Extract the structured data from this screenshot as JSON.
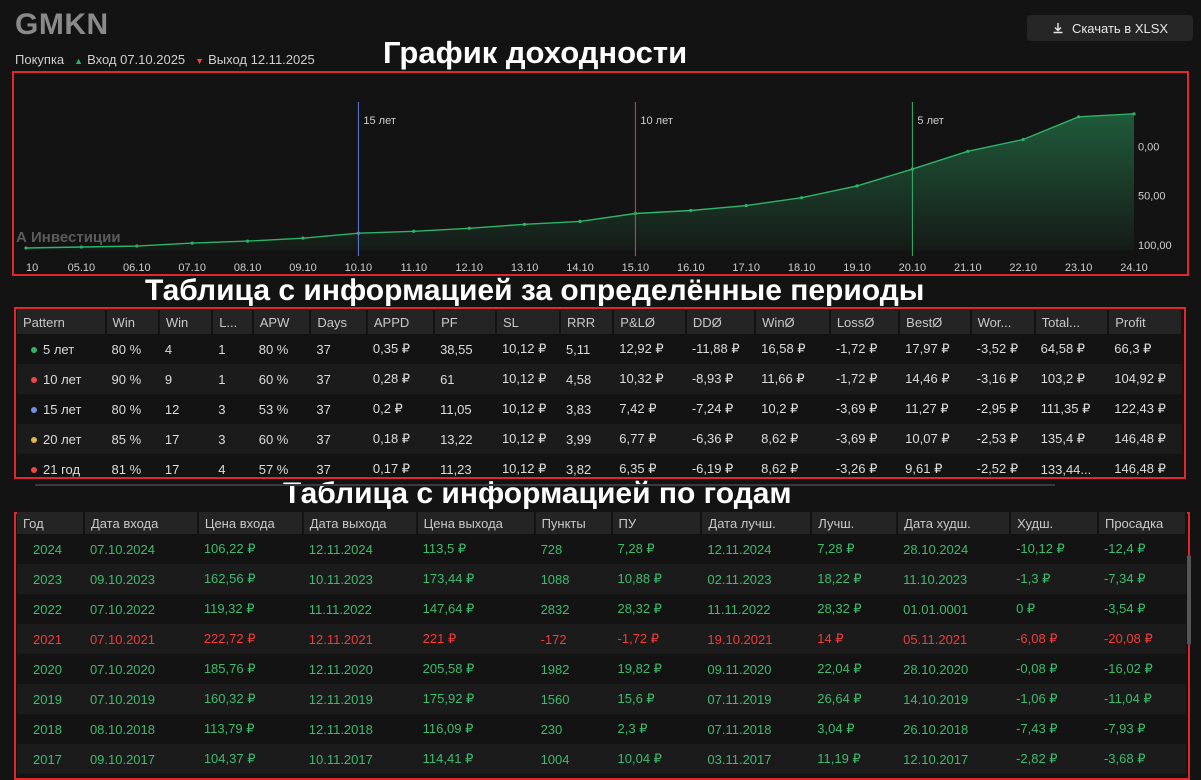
{
  "header": {
    "ticker": "GMKN",
    "side": "Покупка",
    "entry": "Вход 07.10.2025",
    "exit": "Выход 12.11.2025",
    "download_label": "Скачать в XLSX"
  },
  "annotations": {
    "chart": "График доходности",
    "periods": "Таблица с информацией за определённые периоды",
    "years": "Таблица с информацией по годам"
  },
  "chart": {
    "watermark": "А Инвестиции",
    "x_ticks": [
      "10",
      "05.10",
      "06.10",
      "07.10",
      "08.10",
      "09.10",
      "10.10",
      "11.10",
      "12.10",
      "13.10",
      "14.10",
      "15.10",
      "16.10",
      "17.10",
      "18.10",
      "19.10",
      "20.10",
      "21.10",
      "22.10",
      "23.10",
      "24.10"
    ],
    "y_ticks": [
      "100,00",
      "50,00",
      "0,00"
    ],
    "markers": [
      {
        "label": "15 лет",
        "color": "#5b7fd6"
      },
      {
        "label": "10 лет",
        "color": "#d04b4b"
      },
      {
        "label": "5 лет",
        "color": "#2fb36a"
      }
    ],
    "line_color": "#2fb36a"
  },
  "chart_data": {
    "type": "area",
    "x": [
      "10",
      "05.10",
      "06.10",
      "07.10",
      "08.10",
      "09.10",
      "10.10",
      "11.10",
      "12.10",
      "13.10",
      "14.10",
      "15.10",
      "16.10",
      "17.10",
      "18.10",
      "19.10",
      "20.10",
      "21.10",
      "22.10",
      "23.10",
      "24.10"
    ],
    "y": [
      -3,
      -2,
      -1,
      2,
      4,
      7,
      12,
      14,
      17,
      21,
      24,
      32,
      35,
      40,
      48,
      60,
      77,
      95,
      107,
      130,
      133
    ],
    "ylim": [
      -5,
      145
    ],
    "y_ticks": [
      0,
      50,
      100
    ],
    "markers": [
      {
        "x": "10.10",
        "label": "15 лет"
      },
      {
        "x": "15.10",
        "label": "10 лет"
      },
      {
        "x": "20.10",
        "label": "5 лет"
      }
    ],
    "grid": false
  },
  "periods": {
    "columns": [
      "Pattern",
      "Win",
      "Win",
      "L...",
      "APW",
      "Days",
      "APPD",
      "PF",
      "SL",
      "RRR",
      "P&LØ",
      "DDØ",
      "WinØ",
      "LossØ",
      "BestØ",
      "Wor...",
      "Total...",
      "Profit"
    ],
    "rows": [
      {
        "dot": "#2fb36a",
        "cells": [
          "5 лет",
          "80 %",
          "4",
          "1",
          "80 %",
          "37",
          "0,35 ₽",
          "38,55",
          "10,12 ₽",
          "5,11",
          "12,92 ₽",
          "-11,88 ₽",
          "16,58 ₽",
          "-1,72 ₽",
          "17,97 ₽",
          "-3,52 ₽",
          "64,58 ₽",
          "66,3 ₽"
        ]
      },
      {
        "dot": "#e74747",
        "cells": [
          "10 лет",
          "90 %",
          "9",
          "1",
          "60 %",
          "37",
          "0,28 ₽",
          "61",
          "10,12 ₽",
          "4,58",
          "10,32 ₽",
          "-8,93 ₽",
          "11,66 ₽",
          "-1,72 ₽",
          "14,46 ₽",
          "-3,16 ₽",
          "103,2 ₽",
          "104,92 ₽"
        ]
      },
      {
        "dot": "#6f8fe0",
        "cells": [
          "15 лет",
          "80 %",
          "12",
          "3",
          "53 %",
          "37",
          "0,2 ₽",
          "11,05",
          "10,12 ₽",
          "3,83",
          "7,42 ₽",
          "-7,24 ₽",
          "10,2 ₽",
          "-3,69 ₽",
          "11,27 ₽",
          "-2,95 ₽",
          "111,35 ₽",
          "122,43 ₽"
        ]
      },
      {
        "dot": "#e0b24a",
        "cells": [
          "20 лет",
          "85 %",
          "17",
          "3",
          "60 %",
          "37",
          "0,18 ₽",
          "13,22",
          "10,12 ₽",
          "3,99",
          "6,77 ₽",
          "-6,36 ₽",
          "8,62 ₽",
          "-3,69 ₽",
          "10,07 ₽",
          "-2,53 ₽",
          "135,4 ₽",
          "146,48 ₽"
        ]
      },
      {
        "dot": "#e74747",
        "cells": [
          "21 год",
          "81 %",
          "17",
          "4",
          "57 %",
          "37",
          "0,17 ₽",
          "11,23",
          "10,12 ₽",
          "3,82",
          "6,35 ₽",
          "-6,19 ₽",
          "8,62 ₽",
          "-3,26 ₽",
          "9,61 ₽",
          "-2,52 ₽",
          "133,44...",
          "146,48 ₽"
        ]
      }
    ]
  },
  "years": {
    "columns": [
      "Год",
      "Дата входа",
      "Цена входа",
      "Дата выхода",
      "Цена выхода",
      "Пункты",
      "ПУ",
      "Дата лучш.",
      "Лучш.",
      "Дата худш.",
      "Худш.",
      "Просадка"
    ],
    "rows": [
      {
        "status": "pos",
        "cells": [
          "2024",
          "07.10.2024",
          "106,22 ₽",
          "12.11.2024",
          "113,5 ₽",
          "728",
          "7,28 ₽",
          "12.11.2024",
          "7,28 ₽",
          "28.10.2024",
          "-10,12 ₽",
          "-12,4 ₽"
        ]
      },
      {
        "status": "pos",
        "cells": [
          "2023",
          "09.10.2023",
          "162,56 ₽",
          "10.11.2023",
          "173,44 ₽",
          "1088",
          "10,88 ₽",
          "02.11.2023",
          "18,22 ₽",
          "11.10.2023",
          "-1,3 ₽",
          "-7,34 ₽"
        ]
      },
      {
        "status": "pos",
        "cells": [
          "2022",
          "07.10.2022",
          "119,32 ₽",
          "11.11.2022",
          "147,64 ₽",
          "2832",
          "28,32 ₽",
          "11.11.2022",
          "28,32 ₽",
          "01.01.0001",
          "0 ₽",
          "-3,54 ₽"
        ]
      },
      {
        "status": "neg",
        "cells": [
          "2021",
          "07.10.2021",
          "222,72 ₽",
          "12.11.2021",
          "221 ₽",
          "-172",
          "-1,72 ₽",
          "19.10.2021",
          "14 ₽",
          "05.11.2021",
          "-6,08 ₽",
          "-20,08 ₽"
        ]
      },
      {
        "status": "pos",
        "cells": [
          "2020",
          "07.10.2020",
          "185,76 ₽",
          "12.11.2020",
          "205,58 ₽",
          "1982",
          "19,82 ₽",
          "09.11.2020",
          "22,04 ₽",
          "28.10.2020",
          "-0,08 ₽",
          "-16,02 ₽"
        ]
      },
      {
        "status": "pos",
        "cells": [
          "2019",
          "07.10.2019",
          "160,32 ₽",
          "12.11.2019",
          "175,92 ₽",
          "1560",
          "15,6 ₽",
          "07.11.2019",
          "26,64 ₽",
          "14.10.2019",
          "-1,06 ₽",
          "-11,04 ₽"
        ]
      },
      {
        "status": "pos",
        "cells": [
          "2018",
          "08.10.2018",
          "113,79 ₽",
          "12.11.2018",
          "116,09 ₽",
          "230",
          "2,3 ₽",
          "07.11.2018",
          "3,04 ₽",
          "26.10.2018",
          "-7,43 ₽",
          "-7,93 ₽"
        ]
      },
      {
        "status": "pos",
        "cells": [
          "2017",
          "09.10.2017",
          "104,37 ₽",
          "10.11.2017",
          "114,41 ₽",
          "1004",
          "10,04 ₽",
          "03.11.2017",
          "11,19 ₽",
          "12.10.2017",
          "-2,82 ₽",
          "-3,68 ₽"
        ]
      }
    ]
  }
}
